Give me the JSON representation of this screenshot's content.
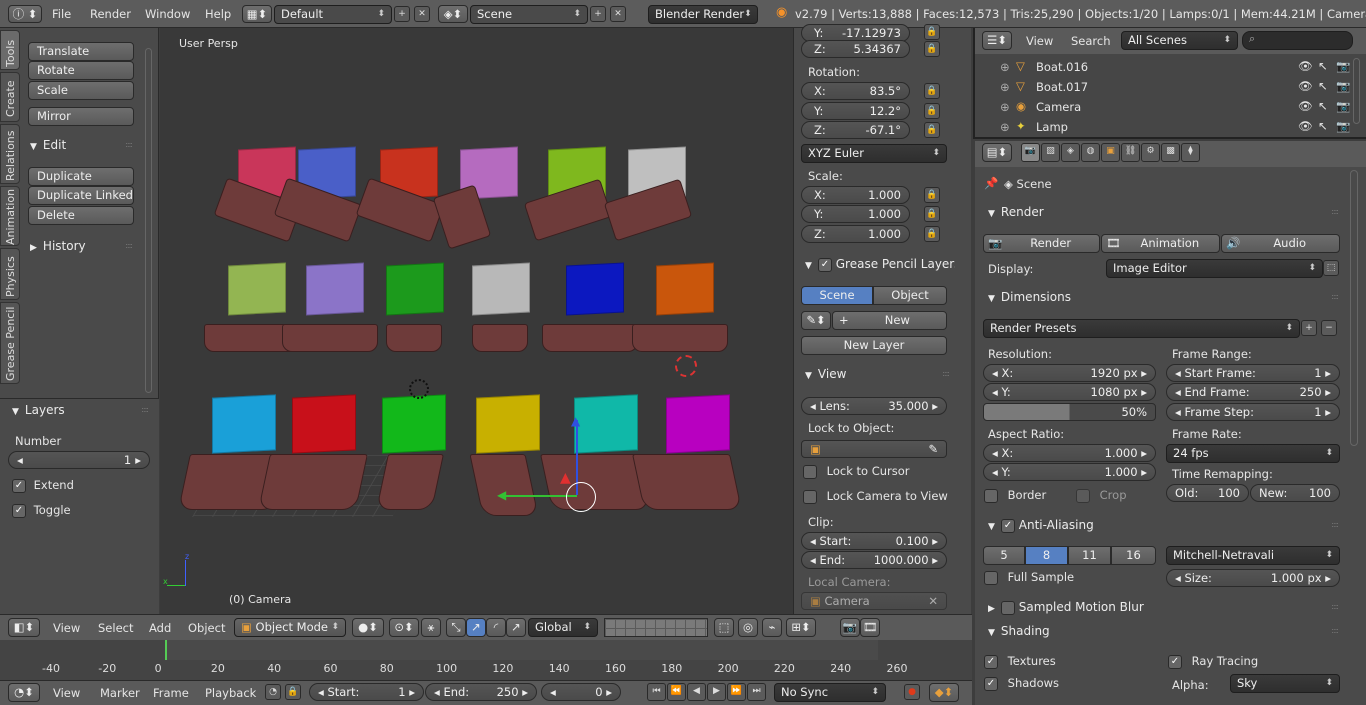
{
  "topbar": {
    "menus": [
      "File",
      "Render",
      "Window",
      "Help"
    ],
    "layout": "Default",
    "scene": "Scene",
    "engine": "Blender Render",
    "stats": "v2.79 | Verts:13,888 | Faces:12,573 | Tris:25,290 | Objects:1/20 | Lamps:0/1 | Mem:44.21M | Camera"
  },
  "toolshelf": {
    "tabs": [
      "Tools",
      "Create",
      "Relations",
      "Animation",
      "Physics",
      "Grease Pencil"
    ],
    "transform": [
      "Translate",
      "Rotate",
      "Scale"
    ],
    "mirror": "Mirror",
    "edit_title": "Edit",
    "edit": [
      "Duplicate",
      "Duplicate Linked",
      "Delete"
    ],
    "history": "History"
  },
  "layers_panel": {
    "title": "Layers",
    "number_label": "Number",
    "number_value": "1",
    "extend": "Extend",
    "toggle": "Toggle"
  },
  "viewport": {
    "view_name": "User Persp",
    "object_label": "(0) Camera"
  },
  "npanel": {
    "loc_y": {
      "k": "Y:",
      "v": "-17.12973"
    },
    "loc_z": {
      "k": "Z:",
      "v": "5.34367"
    },
    "rotation_title": "Rotation:",
    "rot": [
      {
        "k": "X:",
        "v": "83.5°"
      },
      {
        "k": "Y:",
        "v": "12.2°"
      },
      {
        "k": "Z:",
        "v": "-67.1°"
      }
    ],
    "rot_mode": "XYZ Euler",
    "scale_title": "Scale:",
    "scale": [
      {
        "k": "X:",
        "v": "1.000"
      },
      {
        "k": "Y:",
        "v": "1.000"
      },
      {
        "k": "Z:",
        "v": "1.000"
      }
    ],
    "gp_title": "Grease Pencil Layers",
    "gp_scene": "Scene",
    "gp_object": "Object",
    "gp_new": "New",
    "gp_new_layer": "New Layer",
    "view_title": "View",
    "lens": {
      "k": "Lens:",
      "v": "35.000"
    },
    "lock_obj": "Lock to Object:",
    "lock_cursor": "Lock to Cursor",
    "lock_cam": "Lock Camera to View",
    "clip_title": "Clip:",
    "clip_start": {
      "k": "Start:",
      "v": "0.100"
    },
    "clip_end": {
      "k": "End:",
      "v": "1000.000"
    },
    "local_cam": "Local Camera:",
    "local_cam_val": "Camera"
  },
  "outliner": {
    "menus": [
      "View",
      "Search"
    ],
    "filter": "All Scenes",
    "rows": [
      "Boat.016",
      "Boat.017",
      "Camera",
      "Lamp"
    ]
  },
  "props": {
    "context": "Scene",
    "render_title": "Render",
    "render_btns": [
      "Render",
      "Animation",
      "Audio"
    ],
    "display_label": "Display:",
    "display_val": "Image Editor",
    "dimensions_title": "Dimensions",
    "presets": "Render Presets",
    "resolution": "Resolution:",
    "res_x": {
      "k": "X:",
      "v": "1920 px"
    },
    "res_y": {
      "k": "Y:",
      "v": "1080 px"
    },
    "res_pct": "50%",
    "frame_range": "Frame Range:",
    "start_frame": {
      "k": "Start Frame:",
      "v": "1"
    },
    "end_frame": {
      "k": "End Frame:",
      "v": "250"
    },
    "frame_step": {
      "k": "Frame Step:",
      "v": "1"
    },
    "aspect": "Aspect Ratio:",
    "asp_x": {
      "k": "X:",
      "v": "1.000"
    },
    "asp_y": {
      "k": "Y:",
      "v": "1.000"
    },
    "frame_rate": "Frame Rate:",
    "fps": "24 fps",
    "time_remap": "Time Remapping:",
    "old": {
      "k": "Old:",
      "v": "100"
    },
    "new": {
      "k": "New:",
      "v": "100"
    },
    "border": "Border",
    "crop": "Crop",
    "aa_title": "Anti-Aliasing",
    "aa_samples": [
      "5",
      "8",
      "11",
      "16"
    ],
    "aa_filter": "Mitchell-Netravali",
    "full_sample": "Full Sample",
    "size": {
      "k": "Size:",
      "v": "1.000 px"
    },
    "smb_title": "Sampled Motion Blur",
    "shading_title": "Shading",
    "textures": "Textures",
    "ray_tracing": "Ray Tracing",
    "shadows": "Shadows",
    "alpha_label": "Alpha:",
    "alpha_val": "Sky"
  },
  "viewheader": {
    "menus": [
      "View",
      "Select",
      "Add",
      "Object"
    ],
    "mode": "Object Mode",
    "orientation": "Global"
  },
  "timeline": {
    "ticks": [
      "-40",
      "-20",
      "0",
      "20",
      "40",
      "60",
      "80",
      "100",
      "120",
      "140",
      "160",
      "180",
      "200",
      "220",
      "240",
      "260"
    ],
    "menus": [
      "View",
      "Marker",
      "Frame",
      "Playback"
    ],
    "start": {
      "k": "Start:",
      "v": "1"
    },
    "end": {
      "k": "End:",
      "v": "250"
    },
    "current": "0",
    "sync": "No Sync"
  },
  "sail_colors": [
    "#c9365a",
    "#4a5fc8",
    "#c8321e",
    "#b56bbf",
    "#7fb81e",
    "#bfbfbf",
    "#93b552",
    "#8b74c8",
    "#1c9a1c",
    "#b8b8b8",
    "#0c18c0",
    "#c9560c",
    "#1aa0d8",
    "#c8101a",
    "#12b81a",
    "#c8b000",
    "#10b8a8",
    "#b800c0"
  ]
}
